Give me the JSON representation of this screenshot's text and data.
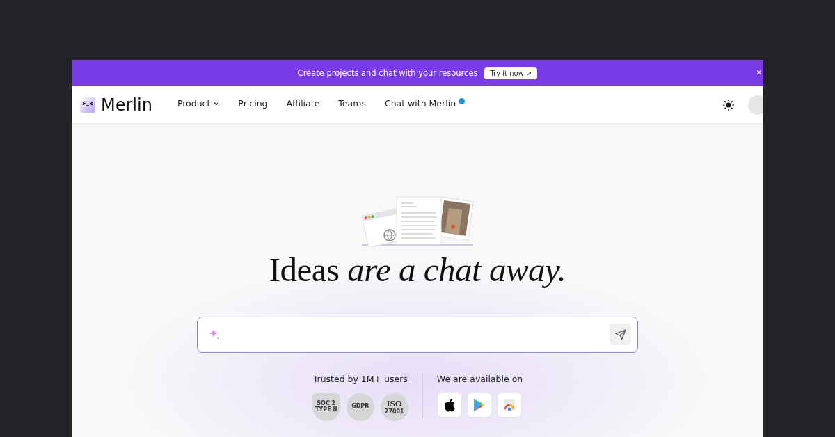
{
  "banner": {
    "text": "Create projects and chat with your resources",
    "button": "Try it now ↗",
    "close": "×"
  },
  "nav": {
    "logo": "Merlin",
    "items": [
      {
        "label": "Product",
        "dropdown": true,
        "notification": false
      },
      {
        "label": "Pricing",
        "dropdown": false,
        "notification": false
      },
      {
        "label": "Affiliate",
        "dropdown": false,
        "notification": false
      },
      {
        "label": "Teams",
        "dropdown": false,
        "notification": false
      },
      {
        "label": "Chat with Merlin",
        "dropdown": false,
        "notification": true
      }
    ]
  },
  "hero": {
    "heading": "Ideas *are a chat away.*"
  },
  "trust": {
    "title": "Trusted by 1M+ users",
    "badges": [
      {
        "kind": "soc",
        "lines": [
          "SOC 2",
          "TYPE II"
        ]
      },
      {
        "kind": "gdpr",
        "lines": [
          "GDPR"
        ]
      },
      {
        "kind": "iso",
        "lines": [
          "ISO",
          "27001"
        ]
      }
    ]
  },
  "platforms": {
    "title": "We are available on",
    "items": [
      {
        "kind": "apple"
      },
      {
        "kind": "play"
      },
      {
        "kind": "chrome"
      }
    ]
  }
}
